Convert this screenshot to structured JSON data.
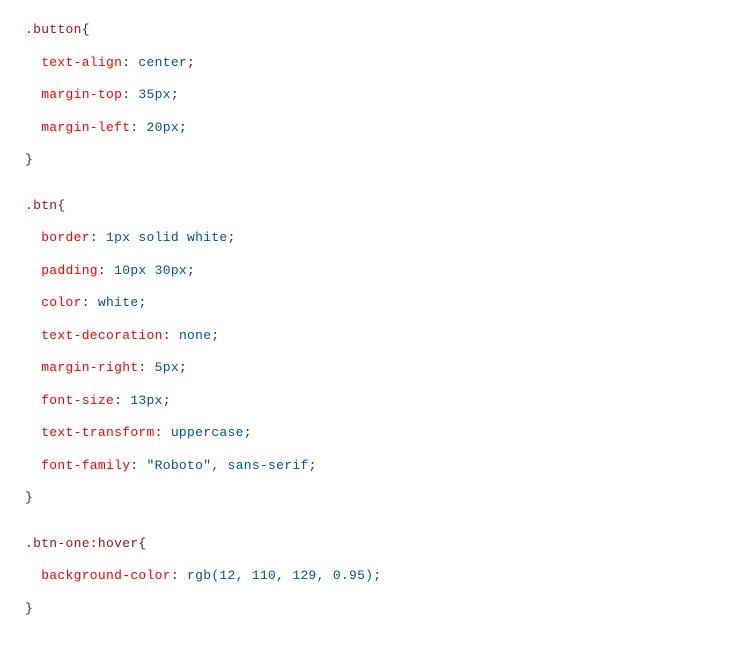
{
  "code": {
    "rules": [
      {
        "selector": ".button",
        "declarations": [
          {
            "prop": "text-align",
            "value": "center"
          },
          {
            "prop": "margin-top",
            "value": "35px"
          },
          {
            "prop": "margin-left",
            "value": "20px"
          }
        ]
      },
      {
        "selector": ".btn",
        "declarations": [
          {
            "prop": "border",
            "value": "1px solid white"
          },
          {
            "prop": "padding",
            "value": "10px 30px"
          },
          {
            "prop": "color",
            "value": "white"
          },
          {
            "prop": "text-decoration",
            "value": "none"
          },
          {
            "prop": "margin-right",
            "value": "5px"
          },
          {
            "prop": "font-size",
            "value": "13px"
          },
          {
            "prop": "text-transform",
            "value": "uppercase"
          },
          {
            "prop": "font-family",
            "value": "\"Roboto\", sans-serif"
          }
        ]
      },
      {
        "selector": ".btn-one:hover",
        "declarations": [
          {
            "prop": "background-color",
            "value": "rgb(12, 110, 129, 0.95)"
          }
        ]
      }
    ]
  }
}
